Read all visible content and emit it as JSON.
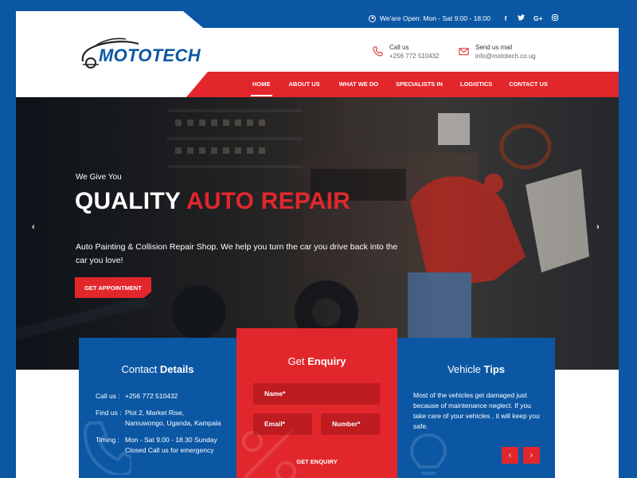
{
  "topbar": {
    "hours": "We'are Open: Mon - Sat 9:00 - 18:00",
    "socials": [
      "f",
      "t",
      "G+",
      "ig"
    ]
  },
  "brand": {
    "name": "MOTOTECH"
  },
  "header": {
    "call": {
      "label": "Call us",
      "value": "+256 772 510432",
      "icon": "phone-icon"
    },
    "mail": {
      "label": "Send us mail",
      "value": "info@mototech.co.ug",
      "icon": "mail-icon"
    }
  },
  "nav": {
    "items": [
      {
        "label": "HOME",
        "active": true
      },
      {
        "label": "ABOUT US"
      },
      {
        "label": "WHAT WE DO"
      },
      {
        "label": "SPECIALISTS IN"
      },
      {
        "label": "LOGISTICS"
      },
      {
        "label": "CONTACT US"
      }
    ]
  },
  "hero": {
    "kicker": "We Give You",
    "title_white": "QUALITY",
    "title_red": "AUTO REPAIR",
    "description": "Auto Painting & Collision Repair Shop. We help you turn the car you drive back into the car you love!",
    "cta": "GET APPOINTMENT",
    "prev_icon": "‹",
    "next_icon": "›"
  },
  "contact_panel": {
    "title_light": "Contact",
    "title_bold": "Details",
    "rows": [
      {
        "key": "Call us :",
        "value": "+256 772 510432"
      },
      {
        "key": "Find us :",
        "value": "Plot 2, Market Rise, Namuwongo, Uganda, Kampala"
      },
      {
        "key": "Timing :",
        "value": "Mon - Sat 9.00 - 18.30 Sunday Closed Call us for emergency"
      }
    ]
  },
  "enquiry_panel": {
    "title_light": "Get",
    "title_bold": "Enquiry",
    "name_placeholder": "Name*",
    "email_placeholder": "Email*",
    "number_placeholder": "Number*",
    "submit": "GET ENQUIRY"
  },
  "tips_panel": {
    "title_light": "Vehicle",
    "title_bold": "Tips",
    "text": "Most of the vehicles get damaged just because of maintenance neglect. If you take care of your vehicles , it will keep you safe.",
    "prev": "‹",
    "next": "›"
  },
  "colors": {
    "blue": "#0b57a4",
    "red": "#e2272c"
  }
}
